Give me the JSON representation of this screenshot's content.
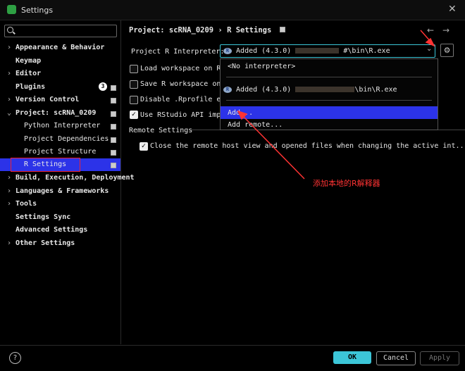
{
  "window": {
    "title": "Settings",
    "close": "✕"
  },
  "search": {
    "placeholder": ""
  },
  "sidebar": {
    "items": [
      {
        "label": "Appearance & Behavior",
        "arrow": "›"
      },
      {
        "label": "Keymap"
      },
      {
        "label": "Editor",
        "arrow": "›"
      },
      {
        "label": "Plugins",
        "badge": "3"
      },
      {
        "label": "Version Control",
        "arrow": "›"
      },
      {
        "label": "Project: scRNA_0209",
        "arrow": "⌄"
      },
      {
        "label": "Python Interpreter"
      },
      {
        "label": "Project Dependencies"
      },
      {
        "label": "Project Structure"
      },
      {
        "label": "R Settings"
      },
      {
        "label": "Build, Execution, Deployment",
        "arrow": "›"
      },
      {
        "label": "Languages & Frameworks",
        "arrow": "›"
      },
      {
        "label": "Tools",
        "arrow": "›"
      },
      {
        "label": "Settings Sync"
      },
      {
        "label": "Advanced Settings"
      },
      {
        "label": "Other Settings",
        "arrow": "›"
      }
    ]
  },
  "breadcrumb": {
    "text": "Project: scRNA_0209 › R Settings"
  },
  "nav": {
    "back": "←",
    "forward": "→"
  },
  "interpreter": {
    "label": "Project R Interpreter:",
    "value_prefix": "Added (4.3.0)",
    "value_suffix": "#\\bin\\R.exe",
    "chevron": "⌄"
  },
  "options": [
    {
      "label": "Load workspace on R",
      "checked": false
    },
    {
      "label": "Save R workspace on",
      "checked": false
    },
    {
      "label": "Disable .Rprofile ex",
      "checked": false
    },
    {
      "label": "Use RStudio API impl",
      "checked": true
    }
  ],
  "remote": {
    "title": "Remote Settings",
    "option": "Close the remote host view and opened files when changing the active int...",
    "checked": true
  },
  "dropdown": {
    "no_interpreter": "<No interpreter>",
    "added_prefix": "Added (4.3.0)",
    "added_suffix": "\\bin\\R.exe",
    "add": "Add...",
    "add_remote": "Add remote..."
  },
  "annotation": {
    "text": "添加本地的R解释器",
    "color": "#ff3333"
  },
  "footer": {
    "help": "?",
    "ok": "OK",
    "cancel": "Cancel",
    "apply": "Apply"
  },
  "colors": {
    "accent": "#3cc6d8",
    "selection": "#2c33e8",
    "annotation": "#ff3333"
  }
}
